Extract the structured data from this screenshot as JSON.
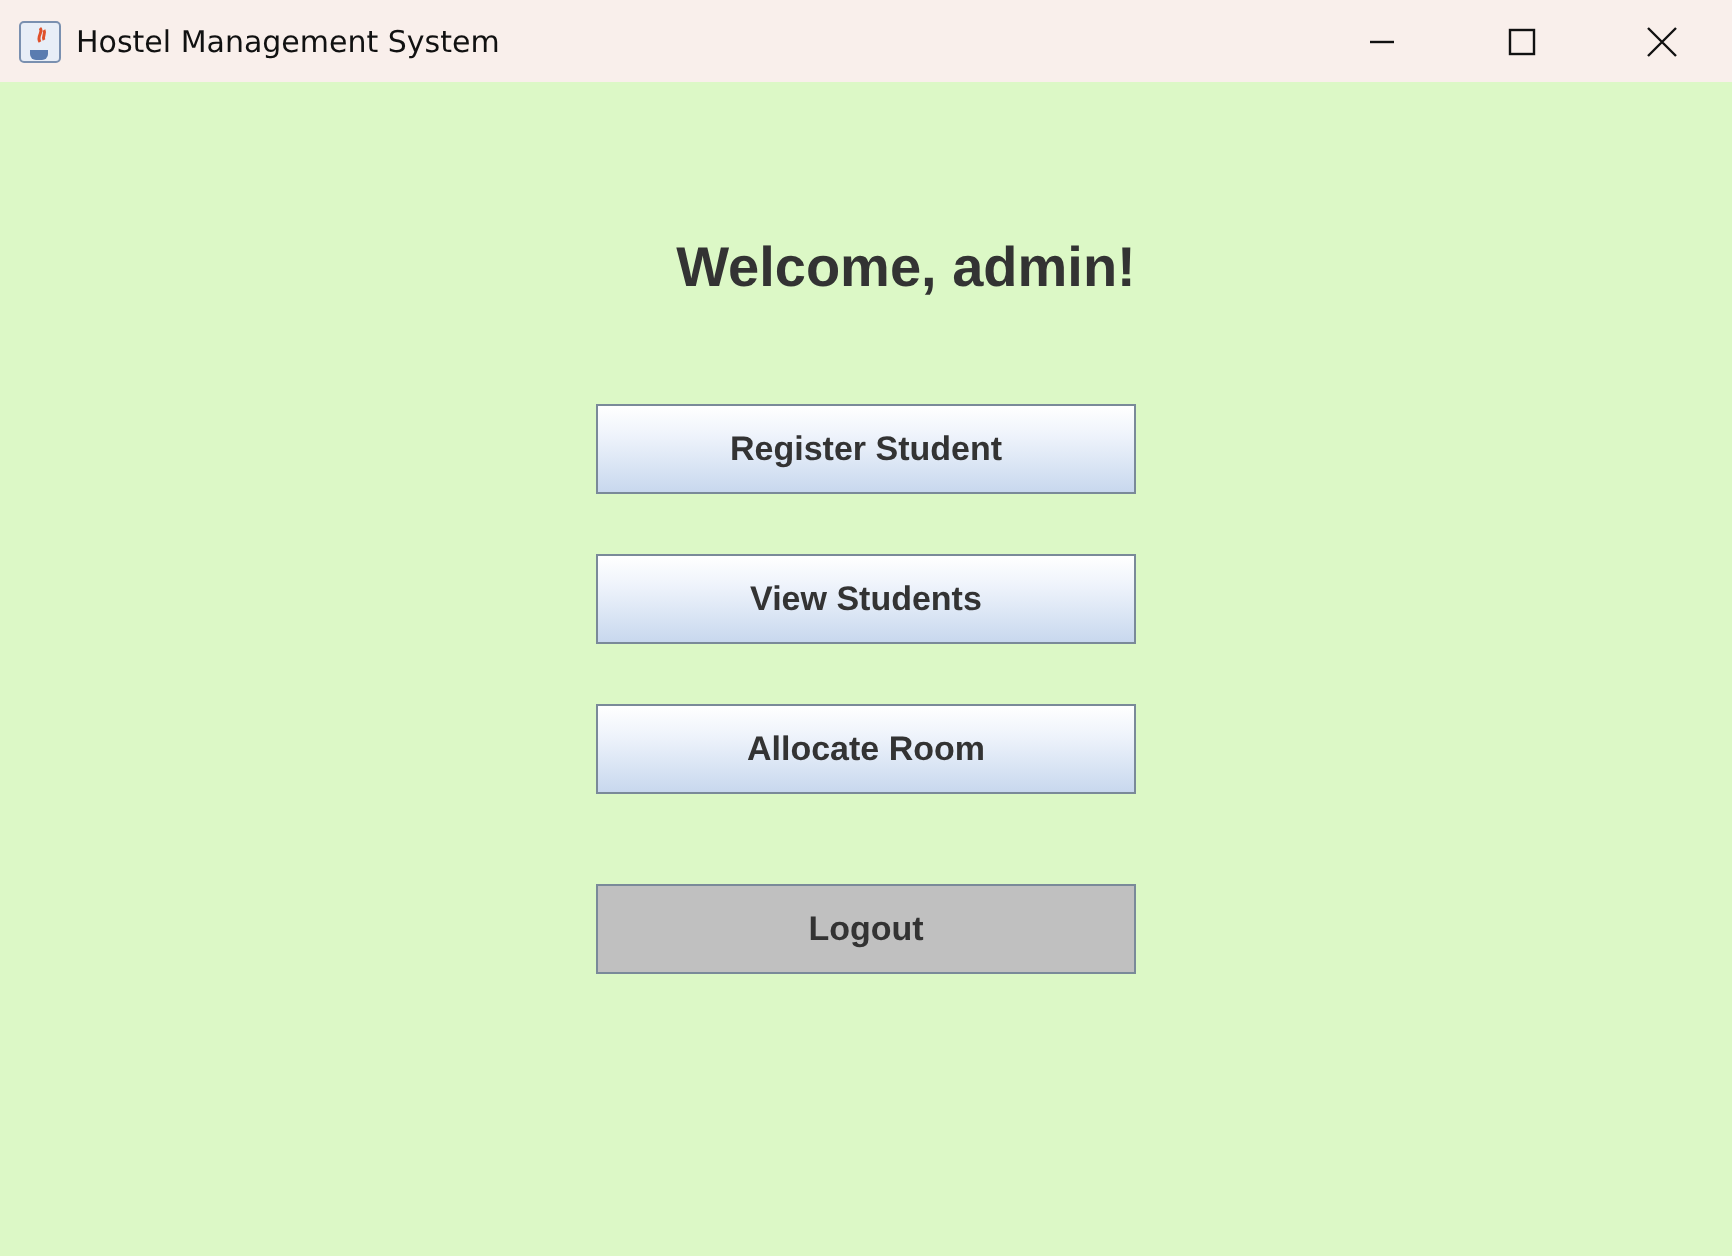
{
  "window": {
    "title": "Hostel Management System"
  },
  "heading": "Welcome, admin!",
  "buttons": [
    {
      "label": "Register Student",
      "kind": "menu"
    },
    {
      "label": "View Students",
      "kind": "menu"
    },
    {
      "label": "Allocate Room",
      "kind": "menu"
    },
    {
      "label": "Logout",
      "kind": "logout"
    }
  ]
}
